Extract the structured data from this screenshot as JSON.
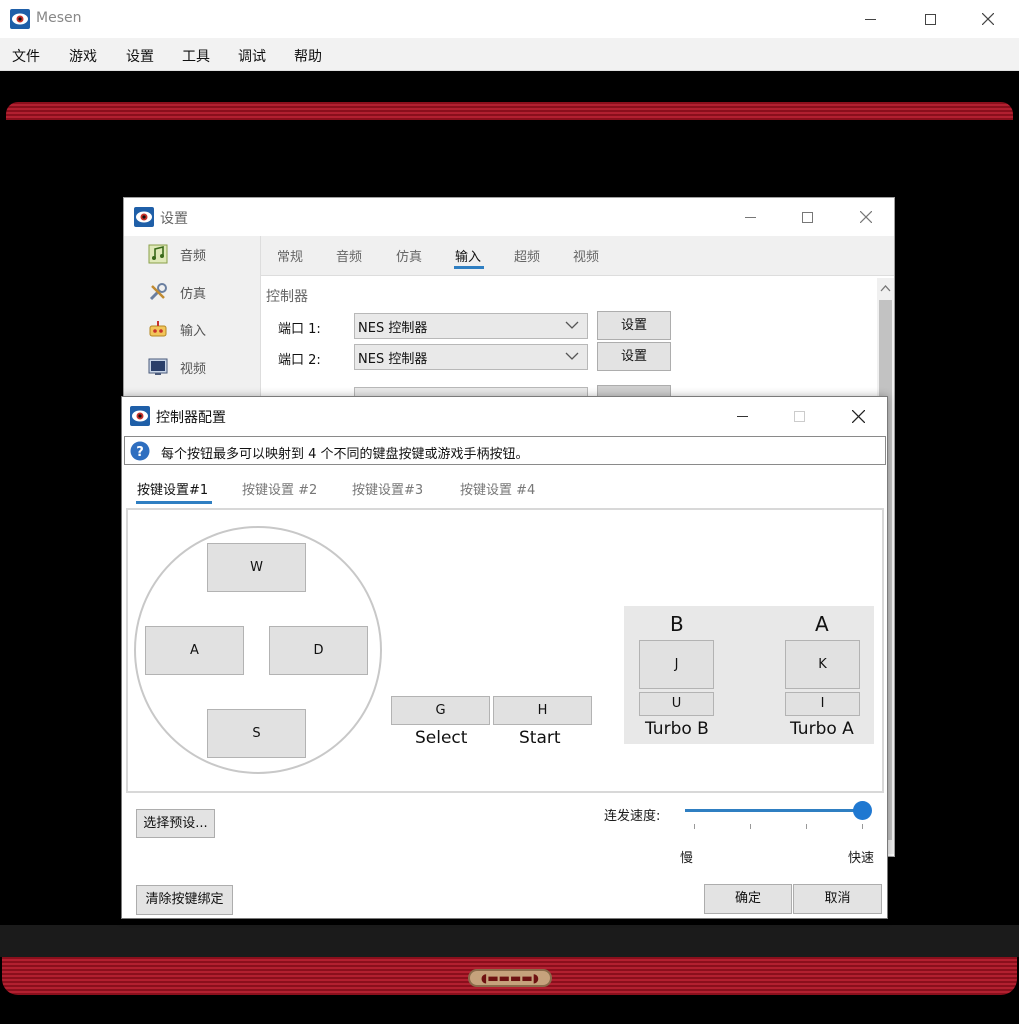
{
  "main_window": {
    "title": "Mesen",
    "menu": [
      "文件",
      "游戏",
      "设置",
      "工具",
      "调试",
      "帮助"
    ]
  },
  "settings_window": {
    "title": "设置",
    "sidebar": [
      {
        "label": "音频",
        "icon": "music-note-icon"
      },
      {
        "label": "仿真",
        "icon": "wrench-icon"
      },
      {
        "label": "输入",
        "icon": "input-icon"
      },
      {
        "label": "视频",
        "icon": "monitor-icon"
      }
    ],
    "tabs": [
      {
        "label": "常规"
      },
      {
        "label": "音频"
      },
      {
        "label": "仿真"
      },
      {
        "label": "输入"
      },
      {
        "label": "超频"
      },
      {
        "label": "视频"
      }
    ],
    "active_tab": "输入",
    "group_title": "控制器",
    "ports": [
      {
        "label": "端口 1:",
        "value": "NES 控制器",
        "button": "设置"
      },
      {
        "label": "端口 2:",
        "value": "NES 控制器",
        "button": "设置"
      }
    ]
  },
  "controller_window": {
    "title": "控制器配置",
    "info_text": "每个按钮最多可以映射到 4 个不同的键盘按键或游戏手柄按钮。",
    "tabs": [
      "按键设置#1",
      "按键设置 #2",
      "按键设置#3",
      "按键设置 #4"
    ],
    "active_tab": "按键设置#1",
    "dpad": {
      "up": "W",
      "left": "A",
      "right": "D",
      "down": "S"
    },
    "select_key": "G",
    "start_key": "H",
    "select_label": "Select",
    "start_label": "Start",
    "b_label": "B",
    "a_label": "A",
    "b_key": "J",
    "a_key": "K",
    "turbo_b_key": "U",
    "turbo_a_key": "I",
    "turbo_b_label": "Turbo B",
    "turbo_a_label": "Turbo A",
    "turbo_speed_label": "连发速度:",
    "turbo_speed_value": 1.0,
    "slow_label": "慢",
    "fast_label": "快速",
    "preset_button": "选择预设...",
    "clear_button": "清除按键绑定",
    "ok_button": "确定",
    "cancel_button": "取消"
  },
  "colors": {
    "accent": "#2f7fc2",
    "stripe_red": "#b22030"
  }
}
